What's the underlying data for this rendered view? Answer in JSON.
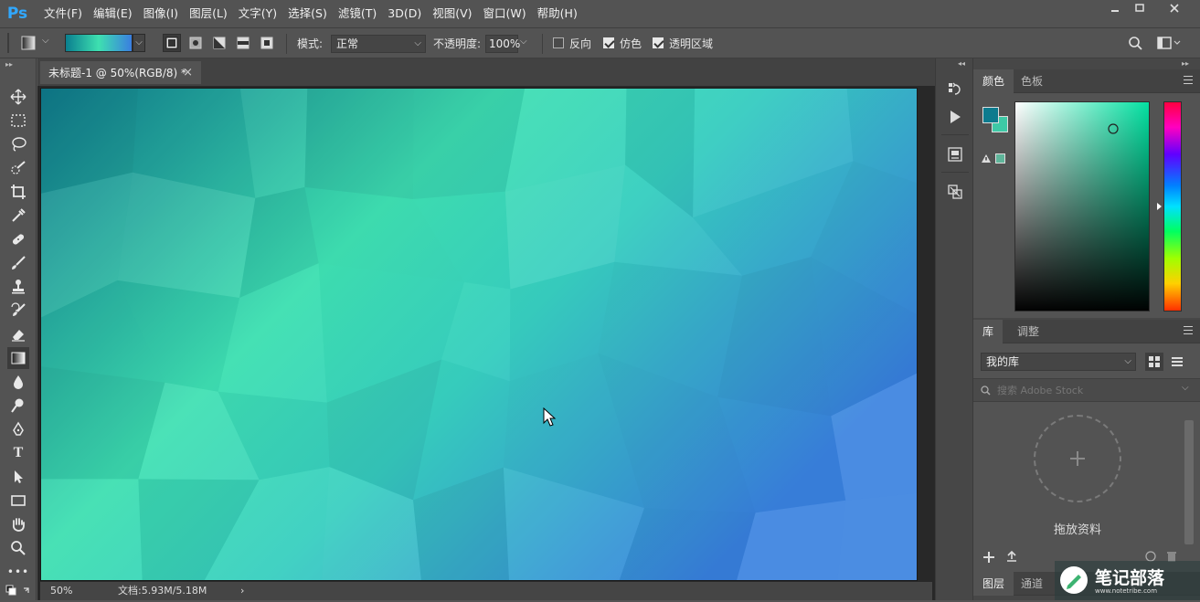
{
  "app": {
    "logo": "Ps"
  },
  "menu": [
    "文件(F)",
    "编辑(E)",
    "图像(I)",
    "图层(L)",
    "文字(Y)",
    "选择(S)",
    "滤镜(T)",
    "3D(D)",
    "视图(V)",
    "窗口(W)",
    "帮助(H)"
  ],
  "options": {
    "mode_label": "模式:",
    "mode_value": "正常",
    "opacity_label": "不透明度:",
    "opacity_value": "100%",
    "reverse_label": "反向",
    "dither_label": "仿色",
    "transparency_label": "透明区域",
    "gradient_colors": [
      "#0a7f8f",
      "#3ee0b0",
      "#3a7ee0"
    ]
  },
  "document": {
    "tab_title": "未标题-1 @ 50%(RGB/8) *",
    "close_glyph": "×",
    "zoom": "50%",
    "doc_info": "文档:5.93M/5.18M",
    "status_arrow": "›"
  },
  "colors": {
    "foreground": "#0d7b8e",
    "background": "#3ec9a6",
    "warning_swatch": "#5fb59a",
    "canvas_gradient": [
      "#0f7a8a",
      "#3fe0b2",
      "#38cfc0",
      "#3a82e0"
    ]
  },
  "color_panel": {
    "tabs": [
      "颜色",
      "色板"
    ],
    "active": 0
  },
  "library_panel": {
    "tabs": [
      "库",
      "调整"
    ],
    "active": 0,
    "library_select": "我的库",
    "search_placeholder": "搜索 Adobe Stock",
    "drop_text": "拖放资料"
  },
  "layers_panel": {
    "tabs": [
      "图层",
      "通道"
    ]
  },
  "watermark": {
    "text": "笔记部落",
    "url": "www.notetribe.com"
  }
}
